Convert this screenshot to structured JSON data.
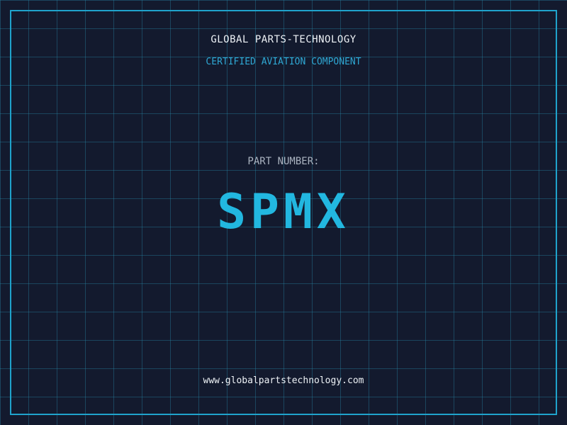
{
  "header": {
    "company": "GLOBAL PARTS-TECHNOLOGY",
    "tagline": "CERTIFIED AVIATION COMPONENT"
  },
  "part": {
    "label": "PART NUMBER:",
    "number": "SPMX"
  },
  "footer": {
    "website": "www.globalpartstechnology.com"
  },
  "colors": {
    "background": "#131a2e",
    "grid": "#288caa",
    "frame": "#1fa3cc",
    "accent": "#22b7e0"
  }
}
